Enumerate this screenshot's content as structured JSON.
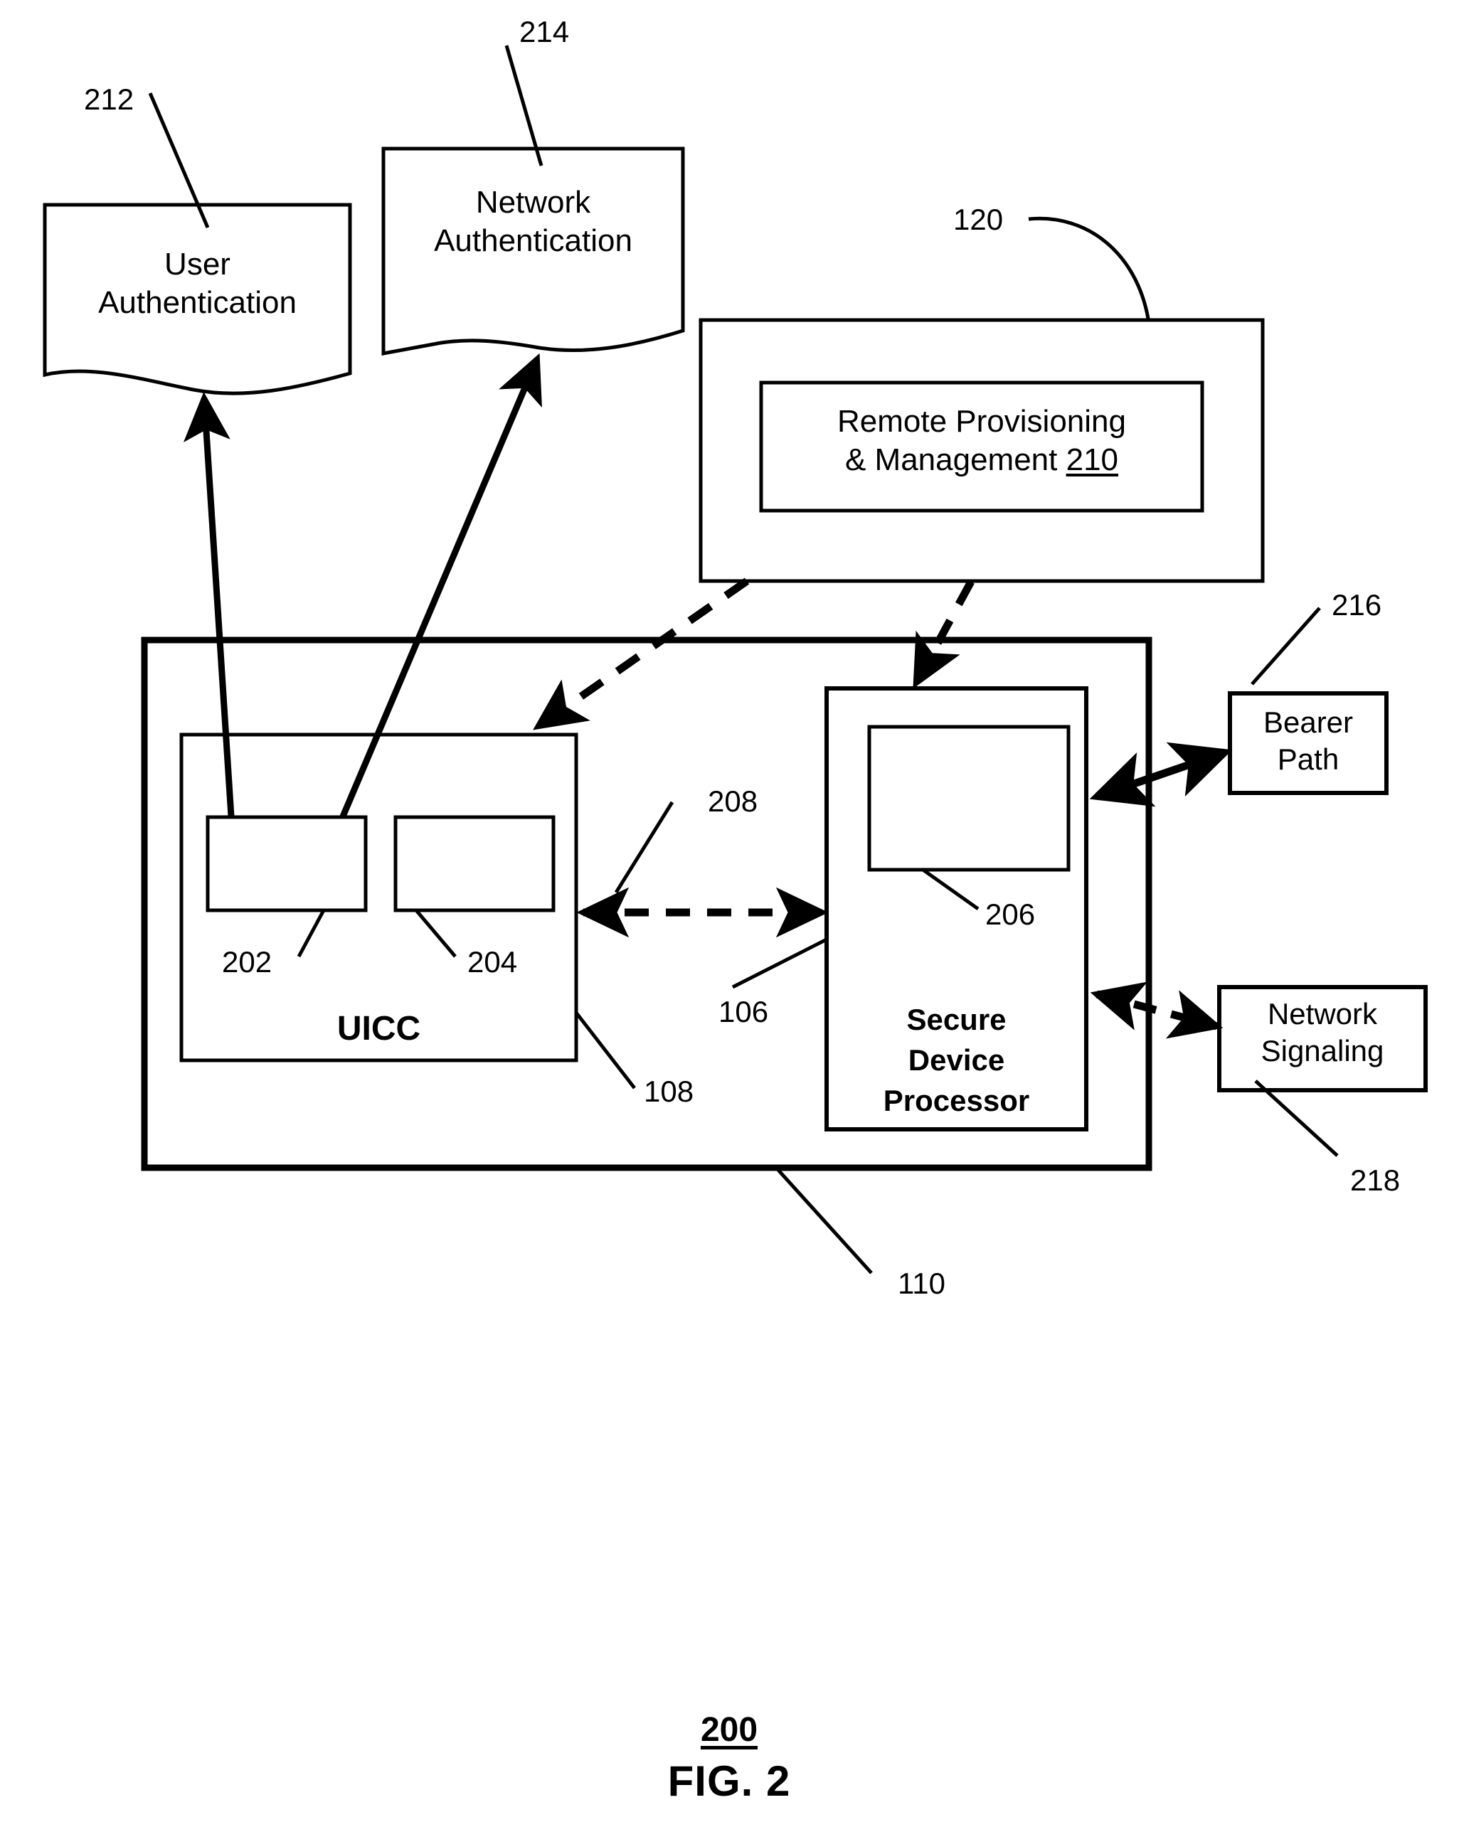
{
  "figure": {
    "number": "200",
    "title": "FIG. 2"
  },
  "nodes": {
    "user_auth": {
      "label": "User\nAuthentication",
      "ref": "212"
    },
    "network_auth": {
      "label": "Network\nAuthentication",
      "ref": "214"
    },
    "provisioning_outer": {
      "ref": "120"
    },
    "provisioning_inner": {
      "label_main": "Remote Provisioning\n& Management ",
      "label_ref": "210"
    },
    "device_outer": {
      "ref": "110"
    },
    "uicc": {
      "label": "UICC",
      "ref": "108"
    },
    "uicc_module_left": {
      "ref": "202"
    },
    "uicc_module_right": {
      "ref": "204"
    },
    "secure_device_processor": {
      "label": "Secure\nDevice\nProcessor",
      "ref": "106"
    },
    "sdp_module": {
      "ref": "206"
    },
    "interface_link": {
      "ref": "208"
    },
    "bearer_path": {
      "label": "Bearer\nPath",
      "ref": "216"
    },
    "network_signaling": {
      "label": "Network\nSignaling",
      "ref": "218"
    }
  },
  "colors": {
    "stroke": "#000000",
    "background": "#ffffff"
  }
}
